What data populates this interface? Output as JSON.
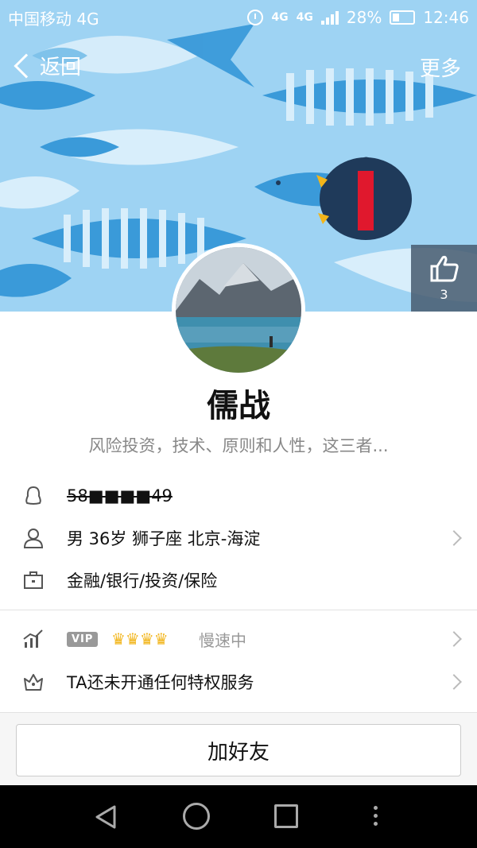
{
  "statusbar": {
    "carrier": "中国移动 4G",
    "network_top": "4G",
    "network2": "4G",
    "battery": "28%",
    "time": "12:46"
  },
  "nav": {
    "back_label": "返回",
    "more_label": "更多"
  },
  "likes": {
    "count": "3",
    "icon": "thumbs-up-icon"
  },
  "profile": {
    "nickname": "儒战",
    "signature": "风险投资，技术、原则和人性，这三者...",
    "qq_number": "58■■■■49",
    "basic_info": "男  36岁  狮子座  北京-海淀",
    "occupation": "金融/银行/投资/保险"
  },
  "vip": {
    "badge": "VIP",
    "crowns": "♛♛♛♛",
    "speed_text": "慢速中"
  },
  "privilege": {
    "text": "TA还未开通任何特权服务"
  },
  "actions": {
    "add_friend": "加好友"
  },
  "colors": {
    "banner_sky": "#8ecaf0",
    "fish_blue": "#3a9ad9",
    "penguin": "#1f3a5a",
    "scarf": "#e0182d"
  }
}
